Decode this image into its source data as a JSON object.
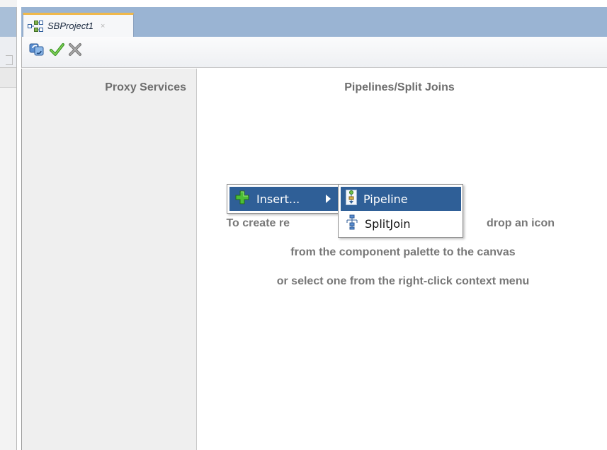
{
  "editor": {
    "tab": {
      "title": "SBProject1",
      "close": "×",
      "icon": "composite-overview-icon"
    },
    "toolbar": [
      {
        "name": "refresh-button",
        "icon": "refresh-icon"
      },
      {
        "name": "validate-button",
        "icon": "green-check-icon"
      },
      {
        "name": "close-button",
        "icon": "close-x-icon"
      }
    ]
  },
  "proxy_services": {
    "title": "Proxy Services"
  },
  "pipelines": {
    "title": "Pipelines/Split Joins",
    "hint_lines": [
      "To create re",
      "drop an icon",
      "from the component palette to the canvas",
      "or select one from the right-click context menu"
    ]
  },
  "context_menu": {
    "insert_label": "Insert...",
    "insert_icon": "green-plus-icon",
    "submenu": [
      {
        "label": "Pipeline",
        "icon": "pipeline-icon",
        "selected": true
      },
      {
        "label": "SplitJoin",
        "icon": "splitjoin-icon",
        "selected": false
      }
    ]
  },
  "colors": {
    "tabbar": "#9ab4d3",
    "menu_highlight": "#2f5f97",
    "active_tab_accent": "#f0b84b"
  }
}
